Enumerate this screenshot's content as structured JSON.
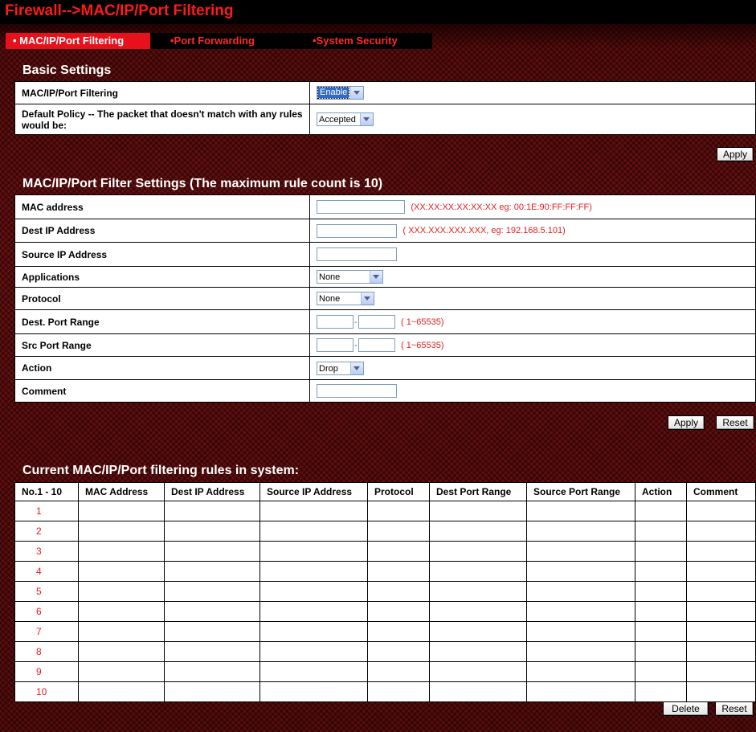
{
  "page_title": "Firewall-->MAC/IP/Port Filtering",
  "tabs": [
    {
      "label": "• MAC/IP/Port Filtering",
      "active": true
    },
    {
      "label": "•Port Forwarding",
      "active": false
    },
    {
      "label": "•System Security",
      "active": false
    }
  ],
  "basic": {
    "heading": "Basic Settings",
    "filtering_label": "MAC/IP/Port Filtering",
    "filtering_value": "Enable",
    "policy_label": "Default Policy -- The packet that doesn't match with any rules would be:",
    "policy_value": "Accepted",
    "apply": "Apply"
  },
  "filter": {
    "heading": "MAC/IP/Port Filter Settings (The maximum rule count is 10)",
    "mac_label": "MAC address",
    "mac_hint": "(XX:XX:XX:XX:XX:XX  eg: 00:1E:90:FF:FF:FF)",
    "dest_ip_label": "Dest IP Address",
    "dest_ip_hint": "( XXX.XXX.XXX.XXX, eg: 192.168.5.101)",
    "src_ip_label": "Source IP Address",
    "apps_label": "Applications",
    "apps_value": "None",
    "protocol_label": "Protocol",
    "protocol_value": "None",
    "dest_port_label": "Dest. Port Range",
    "dest_port_hint": "( 1~65535)",
    "src_port_label": "Src Port Range",
    "src_port_hint": "( 1~65535)",
    "action_label": "Action",
    "action_value": "Drop",
    "comment_label": "Comment",
    "dash": "-",
    "apply": "Apply",
    "reset": "Reset"
  },
  "rules": {
    "heading": "Current MAC/IP/Port filtering rules in system:",
    "columns": [
      "No.1 - 10",
      "MAC Address",
      "Dest IP Address",
      "Source IP Address",
      "Protocol",
      "Dest Port Range",
      "Source Port Range",
      "Action",
      "Comment"
    ],
    "rows": [
      "1",
      "2",
      "3",
      "4",
      "5",
      "6",
      "7",
      "8",
      "9",
      "10"
    ],
    "delete": "Delete",
    "reset": "Reset"
  }
}
